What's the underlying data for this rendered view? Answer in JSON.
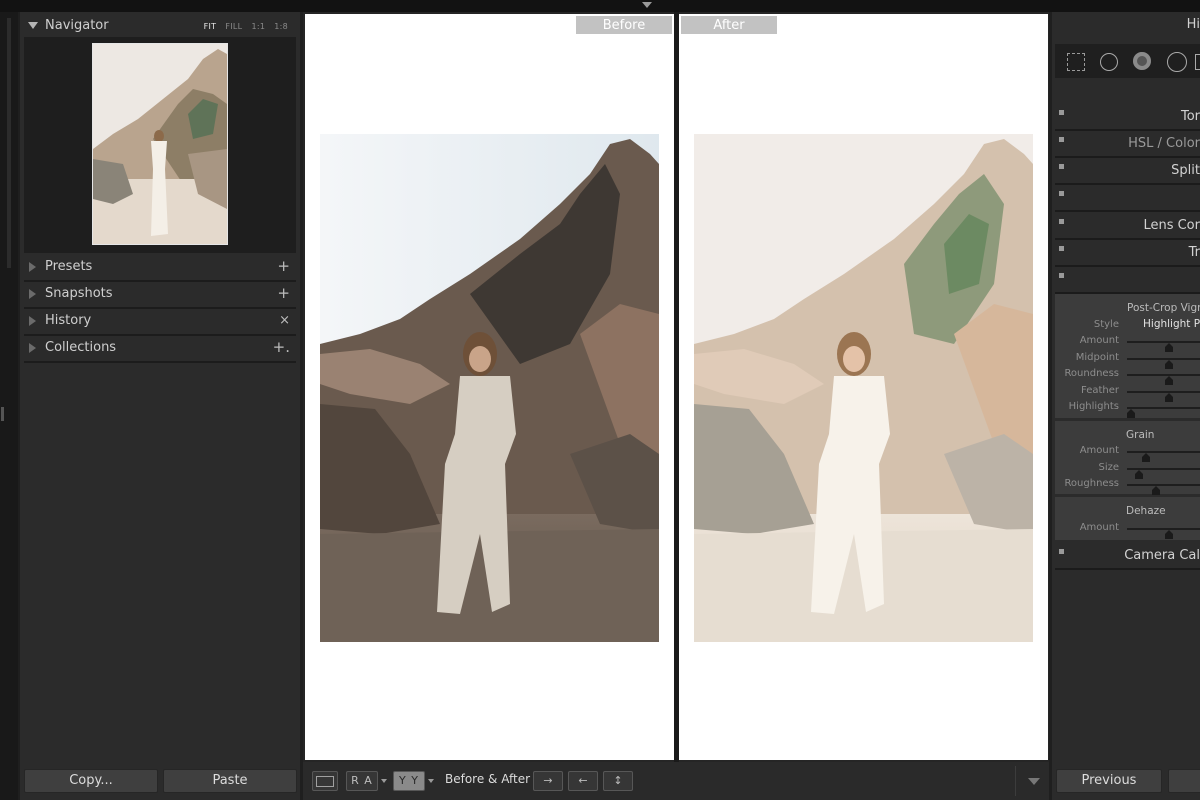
{
  "left_panel": {
    "navigator": {
      "title": "Navigator",
      "zoom": [
        "FIT",
        "FILL",
        "1:1",
        "1:8"
      ],
      "zoom_active": "FIT"
    },
    "sections": [
      {
        "label": "Presets",
        "action": "+"
      },
      {
        "label": "Snapshots",
        "action": "+"
      },
      {
        "label": "History",
        "action": "×"
      },
      {
        "label": "Collections",
        "action": "+."
      }
    ],
    "copy_label": "Copy...",
    "paste_label": "Paste"
  },
  "center": {
    "before_label": "Before",
    "after_label": "After",
    "toolbar": {
      "view_ra_label": "R A",
      "view_yy_label": "Y Y",
      "before_after_label": "Before & After :",
      "swap_arrows": [
        "→",
        "←",
        "↕"
      ]
    }
  },
  "right_panel": {
    "histogram_label": "Hi",
    "sections_top": [
      {
        "label": "Tor"
      },
      {
        "label": "HSL  /  Color"
      },
      {
        "label": "Split"
      },
      {
        "label": ""
      },
      {
        "label": "Lens Cor"
      },
      {
        "label": "Tr"
      },
      {
        "label": ""
      }
    ],
    "effects": {
      "post_crop_title": "Post-Crop Vigne",
      "style_label": "Style",
      "style_value": "Highlight Pr",
      "vignette_sliders": [
        {
          "label": "Amount",
          "value": 0.58
        },
        {
          "label": "Midpoint",
          "value": 0.58
        },
        {
          "label": "Roundness",
          "value": 0.58
        },
        {
          "label": "Feather",
          "value": 0.58
        },
        {
          "label": "Highlights",
          "value": 0.05
        }
      ],
      "grain_title": "Grain",
      "grain_sliders": [
        {
          "label": "Amount",
          "value": 0.26
        },
        {
          "label": "Size",
          "value": 0.16
        },
        {
          "label": "Roughness",
          "value": 0.4
        }
      ],
      "dehaze_title": "Dehaze",
      "dehaze_sliders": [
        {
          "label": "Amount",
          "value": 0.58
        }
      ]
    },
    "camera_cal_label": "Camera Cal",
    "previous_label": "Previous"
  }
}
